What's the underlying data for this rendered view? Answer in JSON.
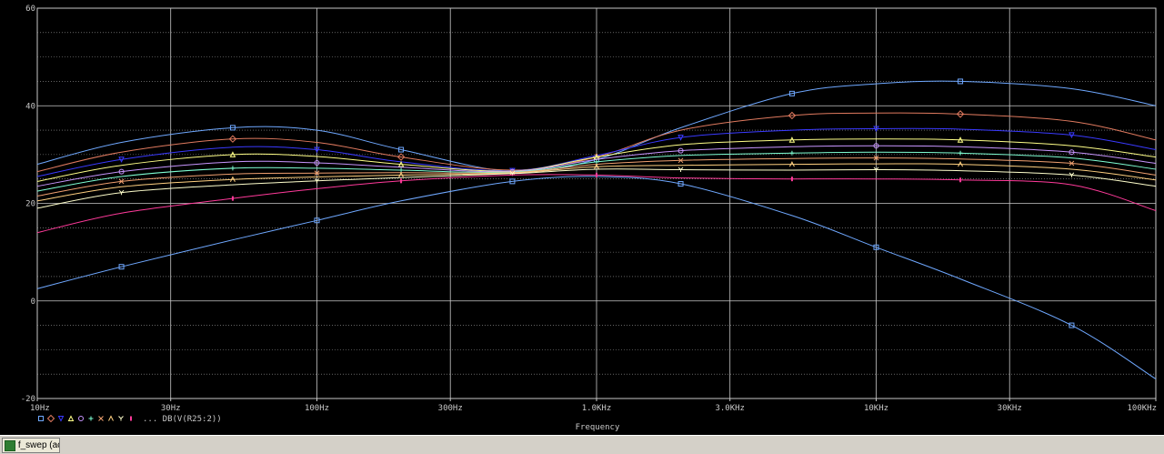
{
  "chart_data": {
    "type": "line",
    "xscale": "log",
    "xlim": [
      10,
      100000
    ],
    "ylim": [
      -20,
      60
    ],
    "grid": true,
    "xlabel": "Frequency",
    "ylabel": "",
    "x_tick_labels": [
      "10Hz",
      "30Hz",
      "100Hz",
      "300Hz",
      "1.0KHz",
      "3.0KHz",
      "10KHz",
      "30KHz",
      "100KHz"
    ],
    "x_tick_values": [
      10,
      30,
      100,
      300,
      1000,
      3000,
      10000,
      30000,
      100000
    ],
    "y_tick_labels": [
      "60",
      "40",
      "20",
      "0",
      "-20"
    ],
    "y_tick_values": [
      60,
      40,
      20,
      0,
      -20
    ],
    "legend_text": "... DB(V(R25:2))",
    "legend_position": "bottom-left",
    "x": [
      10,
      20,
      50,
      100,
      200,
      500,
      1000,
      2000,
      5000,
      10000,
      20000,
      50000,
      100000
    ],
    "series": [
      {
        "color": "#6fa8ff",
        "marker": "square",
        "values": [
          28,
          32.5,
          35.5,
          35,
          31,
          26.5,
          29,
          35.5,
          42.5,
          44.5,
          45,
          43.5,
          40
        ]
      },
      {
        "color": "#6fa8ff",
        "marker": "square",
        "values": [
          2.5,
          7,
          12.5,
          16.5,
          20.5,
          24.5,
          25.5,
          24,
          17.5,
          11,
          4.5,
          -5,
          -16
        ]
      },
      {
        "color": "#e07a5f",
        "marker": "diamond",
        "values": [
          26.5,
          30.5,
          33.2,
          32.5,
          29.5,
          26.8,
          29.5,
          35,
          38,
          38.5,
          38.3,
          36.8,
          33
        ]
      },
      {
        "color": "#3a3aff",
        "marker": "down-triangle",
        "values": [
          25.5,
          29,
          31.5,
          31,
          28.5,
          26.7,
          29.8,
          33.5,
          35,
          35.3,
          35.2,
          34,
          31
        ]
      },
      {
        "color": "#ffff88",
        "marker": "up-triangle",
        "values": [
          24.5,
          27.8,
          30,
          29.6,
          28,
          26.6,
          29.5,
          32,
          33,
          33.2,
          33,
          31.8,
          29.5
        ]
      },
      {
        "color": "#c896ff",
        "marker": "circle",
        "values": [
          23.5,
          26.5,
          28.5,
          28.3,
          27.4,
          26.5,
          29,
          30.8,
          31.6,
          31.8,
          31.6,
          30.5,
          28.2
        ]
      },
      {
        "color": "#7fffd4",
        "marker": "plus",
        "values": [
          22.5,
          25.5,
          27.2,
          27.2,
          26.8,
          26.4,
          28.5,
          29.8,
          30.3,
          30.5,
          30.3,
          29.3,
          27
        ]
      },
      {
        "color": "#f0a070",
        "marker": "x",
        "values": [
          21.5,
          24.5,
          26,
          26.2,
          26.3,
          26.3,
          28,
          28.8,
          29.2,
          29.3,
          29.1,
          28.2,
          25.8
        ]
      },
      {
        "color": "#ffd080",
        "marker": "lambda",
        "values": [
          20.5,
          23.4,
          24.9,
          25.4,
          25.8,
          26.2,
          27.5,
          27.8,
          28,
          28.1,
          28,
          27,
          24.8
        ]
      },
      {
        "color": "#ffffcc",
        "marker": "y",
        "values": [
          19,
          22.2,
          23.8,
          24.6,
          25.3,
          26.1,
          27,
          26.9,
          26.8,
          26.9,
          26.7,
          25.8,
          23.5
        ]
      },
      {
        "color": "#ff3a9a",
        "marker": "bar",
        "values": [
          14,
          18,
          21,
          23,
          24.6,
          25.8,
          25.8,
          25.2,
          25,
          25,
          24.8,
          23.8,
          18.5
        ]
      }
    ]
  },
  "taskbar": {
    "tab_label": "f_swep (act..."
  }
}
